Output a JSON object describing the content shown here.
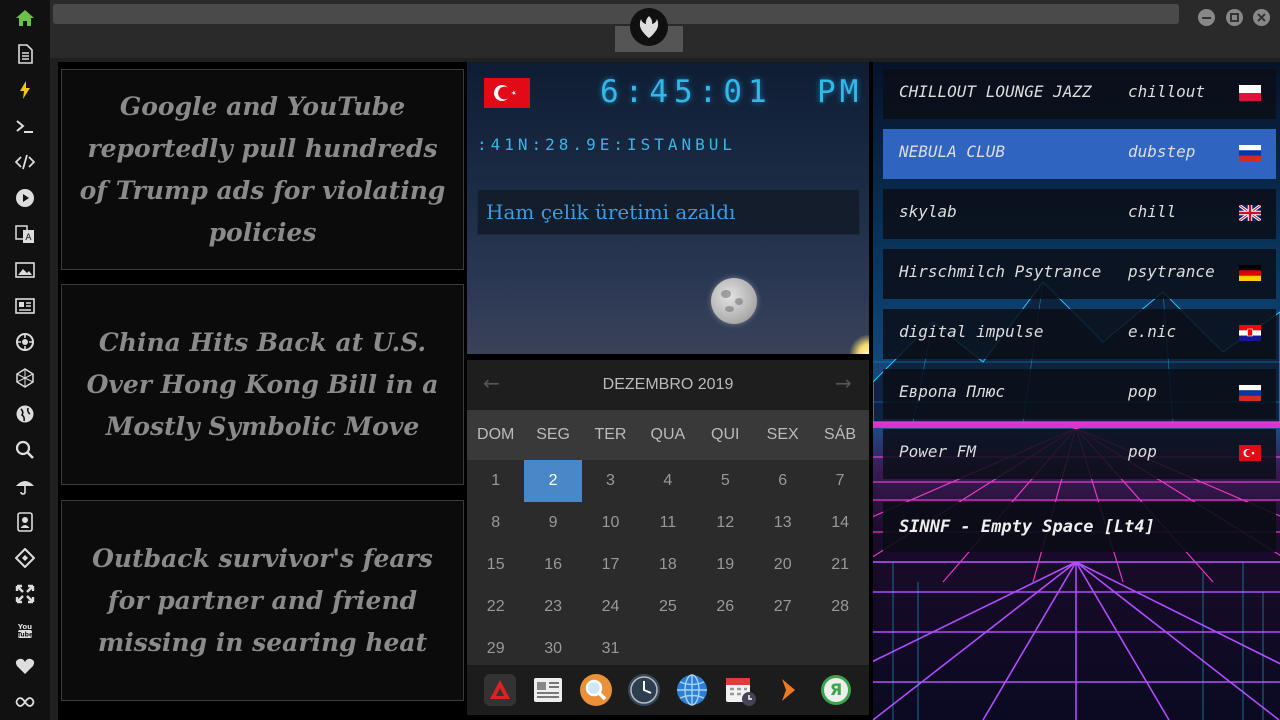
{
  "sidebar": {
    "icons": [
      "home-icon",
      "document-icon",
      "lightning-icon",
      "terminal-icon",
      "code-icon",
      "play-icon",
      "translate-icon",
      "image-icon",
      "news-icon",
      "settings-icon",
      "network-icon",
      "globe-icon",
      "search-icon",
      "umbrella-icon",
      "contacts-icon",
      "tag-icon",
      "expand-icon",
      "youtube-icon",
      "heart-icon",
      "infinity-icon"
    ]
  },
  "news": [
    {
      "headline": "Google and YouTube reportedly pull hundreds of Trump ads for violating policies"
    },
    {
      "headline": "China Hits Back at U.S. Over Hong Kong Bill in a Mostly Symbolic Move"
    },
    {
      "headline": "Outback survivor's fears for partner and friend missing in searing heat"
    }
  ],
  "clock": {
    "time": "6:45:01",
    "ampm": "PM",
    "location": ":41N:28.9E:ISTANBUL",
    "headline": "Ham çelik üretimi azaldı",
    "flag": "turkey"
  },
  "calendar": {
    "month_label": "DEZEMBRO 2019",
    "prev_label": "←",
    "next_label": "→",
    "weekdays": [
      "DOM",
      "SEG",
      "TER",
      "QUA",
      "QUI",
      "SEX",
      "SÁB"
    ],
    "days": [
      [
        "1",
        "2",
        "3",
        "4",
        "5",
        "6",
        "7"
      ],
      [
        "8",
        "9",
        "10",
        "11",
        "12",
        "13",
        "14"
      ],
      [
        "15",
        "16",
        "17",
        "18",
        "19",
        "20",
        "21"
      ],
      [
        "22",
        "23",
        "24",
        "25",
        "26",
        "27",
        "28"
      ],
      [
        "29",
        "30",
        "31"
      ]
    ],
    "selected_day": "2"
  },
  "dock": {
    "apps": [
      "launcher-icon",
      "news-app-icon",
      "magnifier-icon",
      "clock-app-icon",
      "globe-app-icon",
      "calendar-app-icon",
      "forward-arrow-icon",
      "yandex-icon"
    ],
    "yandex_letter": "Я"
  },
  "radio": {
    "stations": [
      {
        "name": "CHILLOUT LOUNGE JAZZ",
        "genre": "chillout",
        "flag": "poland",
        "active": false
      },
      {
        "name": "NEBULA CLUB",
        "genre": "dubstep",
        "flag": "russia",
        "active": true
      },
      {
        "name": "skylab",
        "genre": "chill",
        "flag": "uk",
        "active": false
      },
      {
        "name": "Hirschmilch Psytrance",
        "genre": "psytrance",
        "flag": "germany",
        "active": false
      },
      {
        "name": "digital impulse",
        "genre": "e.nic",
        "flag": "croatia",
        "active": false
      },
      {
        "name": "Европа Плюс",
        "genre": "pop",
        "flag": "russia",
        "active": false
      },
      {
        "name": "Power FM",
        "genre": "pop",
        "flag": "turkey",
        "active": false
      }
    ],
    "now_playing": "SINNF - Empty Space [Lt4]"
  },
  "colors": {
    "accent_green": "#6cc04a",
    "clock_digits": "#35b8e8",
    "selected_day": "#4a87c8",
    "active_station": "#2f64c0"
  }
}
